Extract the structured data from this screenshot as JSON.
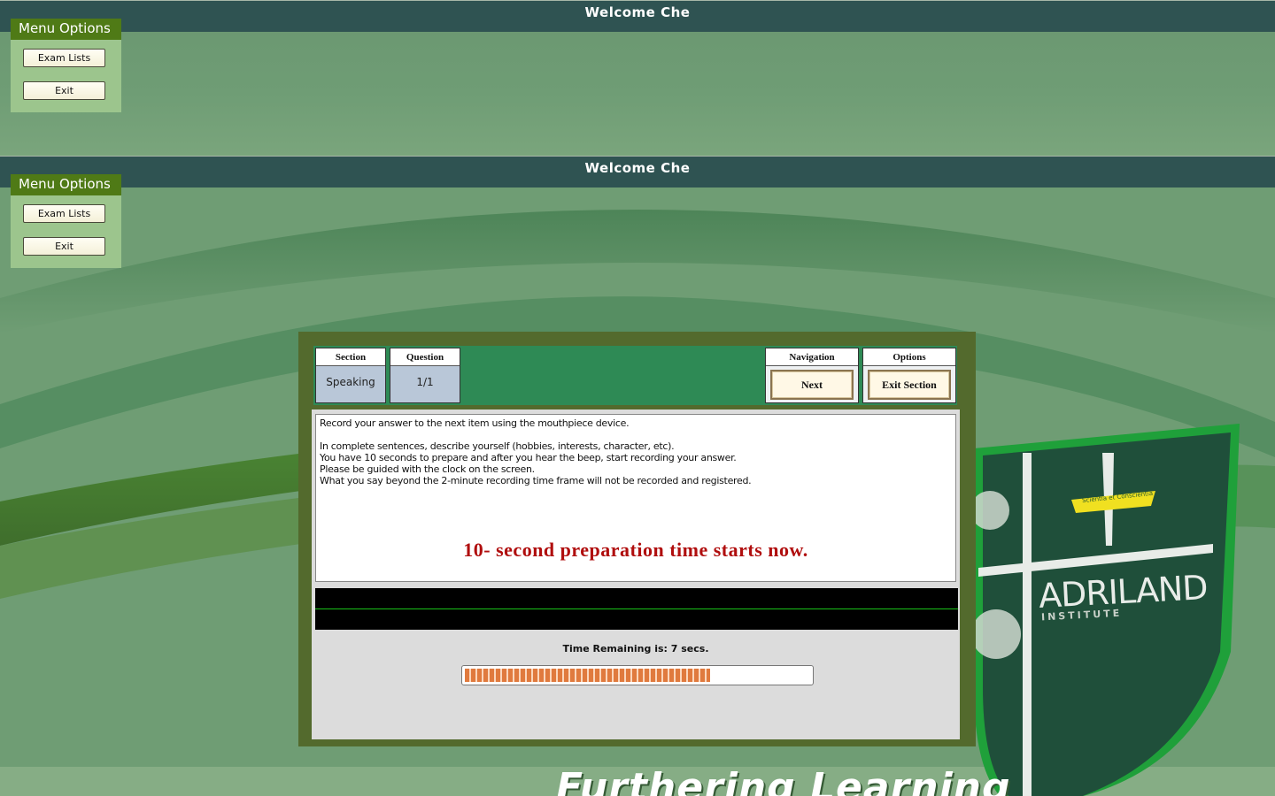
{
  "windows": [
    {
      "title": "Welcome   Che",
      "menu": {
        "header": "Menu Options",
        "items": [
          "Exam Lists",
          "Exit"
        ]
      }
    },
    {
      "title": "Welcome   Che",
      "menu": {
        "header": "Menu Options",
        "items": [
          "Exam Lists",
          "Exit"
        ]
      }
    }
  ],
  "exam": {
    "section_label": "Section",
    "section_value": "Speaking",
    "question_label": "Question",
    "question_value": "1/1",
    "navigation_label": "Navigation",
    "next_label": "Next",
    "options_label": "Options",
    "exit_section_label": "Exit Section",
    "instructions": [
      "Record your answer to the next item using the mouthpiece device.",
      "",
      "In complete sentences, describe yourself (hobbies, interests, character, etc).",
      "You have 10 seconds to prepare and after you hear the beep, start recording your answer.",
      "Please be guided with the clock on the screen.",
      "What you say beyond the 2-minute recording time frame will not be recorded and registered."
    ],
    "prep_message": "10- second preparation time starts now.",
    "timer_text": "Time Remaining is: 7 secs.",
    "progress_percent": 71
  },
  "branding": {
    "logo_name": "ADRILAND",
    "logo_sub": "INSTITUTE",
    "motto_ribbon": "Scientia et Conscientia",
    "tagline": "Furthering Learning"
  },
  "colors": {
    "titlebar": "#2f5352",
    "menu_header": "#4f7a16",
    "panel_frame": "#536a2d",
    "panel_header": "#2e8a55",
    "prep_text": "#b00e0e",
    "progress": "#e07a3e"
  }
}
